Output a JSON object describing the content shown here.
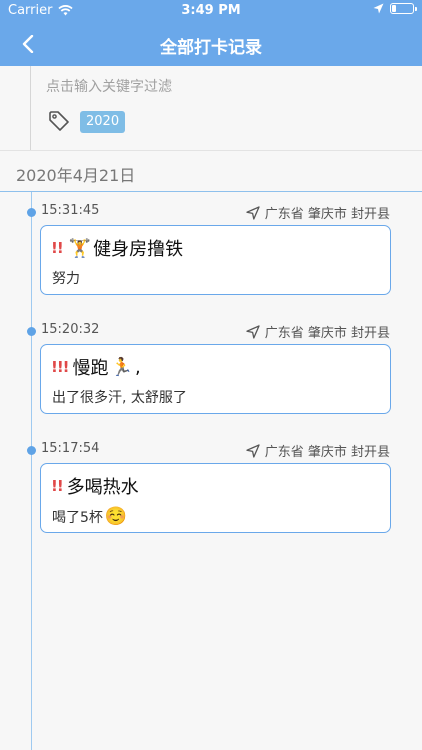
{
  "status_bar": {
    "carrier": "Carrier",
    "time": "3:49 PM",
    "wifi_icon": "wifi-icon",
    "location_icon": "location-arrow-icon",
    "battery_icon": "battery-icon"
  },
  "nav": {
    "title": "全部打卡记录",
    "back_icon": "chevron-left-icon"
  },
  "filter": {
    "placeholder": "点击输入关键字过滤",
    "tag_icon": "tag-icon",
    "tags": [
      "2020"
    ]
  },
  "date_header": "2020年4月21日",
  "entries": [
    {
      "time": "15:31:45",
      "location": "广东省 肇庆市 封开县",
      "priority": "!!",
      "title_emoji": "🏋️",
      "title": "健身房撸铁",
      "note": "努力",
      "note_emoji": ""
    },
    {
      "time": "15:20:32",
      "location": "广东省 肇庆市 封开县",
      "priority": "!!!",
      "title": "慢跑",
      "title_emoji": "🏃",
      "title_suffix": ",",
      "note": "出了很多汗, 太舒服了",
      "note_emoji": ""
    },
    {
      "time": "15:17:54",
      "location": "广东省 肇庆市 封开县",
      "priority": "!!",
      "title": "多喝热水",
      "title_emoji": "",
      "note": "喝了5杯",
      "note_emoji": "☺️"
    }
  ],
  "colors": {
    "nav_bg": "#6aa8ea",
    "accent": "#5fa3e6",
    "priority": "#e04848",
    "tag_bg": "#7fbde6"
  }
}
